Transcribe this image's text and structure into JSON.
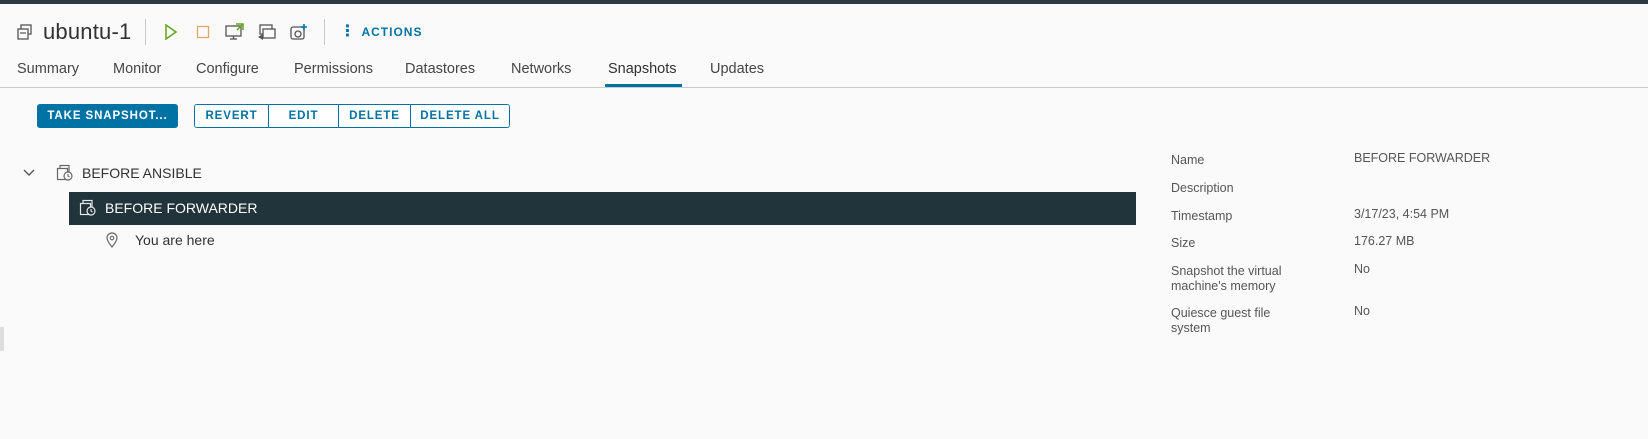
{
  "header": {
    "title": "ubuntu-1",
    "actions_label": "ACTIONS",
    "toolbar_icons": [
      "vm-icon",
      "power-on-icon",
      "power-off-icon",
      "launch-console-icon",
      "migrate-icon",
      "snapshot-icon"
    ]
  },
  "tabs": [
    {
      "label": "Summary"
    },
    {
      "label": "Monitor"
    },
    {
      "label": "Configure"
    },
    {
      "label": "Permissions"
    },
    {
      "label": "Datastores"
    },
    {
      "label": "Networks"
    },
    {
      "label": "Snapshots",
      "active": true
    },
    {
      "label": "Updates"
    }
  ],
  "toolbar": {
    "take_snapshot": "TAKE SNAPSHOT...",
    "revert": "REVERT",
    "edit": "EDIT",
    "delete": "DELETE",
    "delete_all": "DELETE ALL"
  },
  "tree": {
    "root": "BEFORE ANSIBLE",
    "child": "BEFORE FORWARDER",
    "current": "You are here"
  },
  "details": {
    "name_label": "Name",
    "name_value": "BEFORE FORWARDER",
    "description_label": "Description",
    "description_value": "",
    "timestamp_label": "Timestamp",
    "timestamp_value": "3/17/23, 4:54 PM",
    "size_label": "Size",
    "size_value": "176.27 MB",
    "memory_label_1": "Snapshot the virtual",
    "memory_label_2": "machine's memory",
    "memory_value": "No",
    "quiesce_label_1": "Quiesce guest file",
    "quiesce_label_2": "system",
    "quiesce_value": "No"
  },
  "colors": {
    "accent": "#0072a3",
    "selected_row": "#21333b",
    "power_on": "#62a420",
    "power_off": "#e2a766"
  }
}
